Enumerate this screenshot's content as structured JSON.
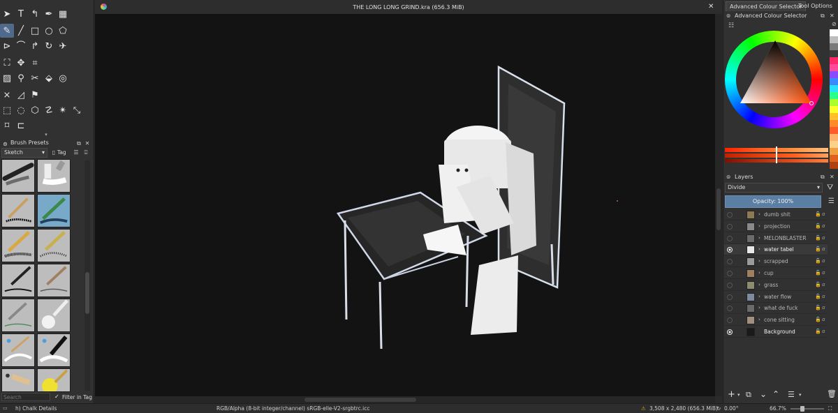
{
  "window": {
    "title": "THE LONG LONG GRIND.kra (656.3 MiB)",
    "close_glyph": "✕"
  },
  "toolbox": {
    "tools": [
      {
        "icon": "pointer-icon",
        "glyph": "➤"
      },
      {
        "icon": "text-tool-icon",
        "glyph": "T"
      },
      {
        "icon": "edit-shapes-icon",
        "glyph": "↰"
      },
      {
        "icon": "calligraphy-icon",
        "glyph": "✒"
      },
      {
        "icon": "assistant-tool-icon",
        "glyph": "▦"
      },
      {
        "icon": "freehand-brush-icon",
        "glyph": "✎"
      },
      {
        "icon": "line-tool-icon",
        "glyph": "╱"
      },
      {
        "icon": "rectangle-tool-icon",
        "glyph": "□"
      },
      {
        "icon": "ellipse-tool-icon",
        "glyph": "○"
      },
      {
        "icon": "polygon-tool-icon",
        "glyph": "⬠"
      },
      {
        "icon": "polyline-tool-icon",
        "glyph": "⊳"
      },
      {
        "icon": "bezier-curve-icon",
        "glyph": "⌒"
      },
      {
        "icon": "freehand-path-icon",
        "glyph": "↱"
      },
      {
        "icon": "dynamic-brush-icon",
        "glyph": "↻"
      },
      {
        "icon": "multibrush-icon",
        "glyph": "✈"
      },
      {
        "icon": "transform-tool-icon",
        "glyph": "⛶"
      },
      {
        "icon": "move-tool-icon",
        "glyph": "✥"
      },
      {
        "icon": "crop-tool-icon",
        "glyph": "⌗"
      },
      {
        "icon": "gradient-tool-icon",
        "glyph": "▨"
      },
      {
        "icon": "color-picker-icon",
        "glyph": "⚲"
      },
      {
        "icon": "smart-patch-icon",
        "glyph": "✂"
      },
      {
        "icon": "fill-tool-icon",
        "glyph": "⬙"
      },
      {
        "icon": "enclose-fill-icon",
        "glyph": "◎"
      },
      {
        "icon": "assistant-perspective-icon",
        "glyph": "⨯"
      },
      {
        "icon": "measure-tool-icon",
        "glyph": "◿"
      },
      {
        "icon": "reference-image-icon",
        "glyph": "⚑"
      },
      {
        "icon": "rect-select-icon",
        "glyph": "⬚"
      },
      {
        "icon": "ellipse-select-icon",
        "glyph": "◌"
      },
      {
        "icon": "polygon-select-icon",
        "glyph": "⬡"
      },
      {
        "icon": "freehand-select-icon",
        "glyph": "☡"
      },
      {
        "icon": "contiguous-select-icon",
        "glyph": "✴"
      },
      {
        "icon": "similar-select-icon",
        "glyph": "⤡"
      },
      {
        "icon": "bezier-select-icon",
        "glyph": "⌑"
      },
      {
        "icon": "magnetic-select-icon",
        "glyph": "⊏"
      }
    ]
  },
  "brush_presets": {
    "title": "Brush Presets",
    "tag_value": "Sketch",
    "tag_label": "Tag",
    "search_placeholder": "Search",
    "filter_label": "Filter in Tag",
    "filter_checked": true
  },
  "color_selector": {
    "tabs": [
      "Advanced Colour Selector",
      "Tool Options"
    ],
    "panel_title": "Advanced Colour Selector"
  },
  "layers": {
    "title": "Layers",
    "blend_mode": "Divide",
    "opacity_label": "Opacity: 100%",
    "items": [
      {
        "name": "dumb shit",
        "visible": false,
        "group": true,
        "selected": false,
        "thumb": "#8c7a55"
      },
      {
        "name": "projection",
        "visible": false,
        "group": true,
        "selected": false,
        "thumb": "#8a8a8a"
      },
      {
        "name": "MELONBLASTER",
        "visible": false,
        "group": true,
        "selected": false,
        "thumb": "#6b6b6b"
      },
      {
        "name": "water tabel",
        "visible": true,
        "group": true,
        "selected": true,
        "thumb": "#e8e8e8"
      },
      {
        "name": "scrapped",
        "visible": false,
        "group": true,
        "selected": false,
        "thumb": "#9a9a9a"
      },
      {
        "name": "cup",
        "visible": false,
        "group": true,
        "selected": false,
        "thumb": "#a08060"
      },
      {
        "name": "grass",
        "visible": false,
        "group": true,
        "selected": false,
        "thumb": "#8c8c6e"
      },
      {
        "name": "water flow",
        "visible": false,
        "group": true,
        "selected": false,
        "thumb": "#7e8aa0"
      },
      {
        "name": "what de fuck",
        "visible": false,
        "group": true,
        "selected": false,
        "thumb": "#6a6a6a"
      },
      {
        "name": "cone sitting",
        "visible": false,
        "group": true,
        "selected": false,
        "thumb": "#a09080"
      },
      {
        "name": "Background",
        "visible": true,
        "group": false,
        "selected": false,
        "thumb": "#1a1a1a"
      }
    ]
  },
  "status": {
    "brush_name": "h) Chalk Details",
    "color_profile": "RGB/Alpha (8-bit integer/channel)  sRGB-elle-V2-srgbtrc.icc",
    "image_size": "3,508 x 2,480 (656.3 MiB)",
    "rotation": "0.00°",
    "zoom": "66.7%"
  },
  "colors": {
    "accent": "#4f6a8a",
    "canvas_bg": "#131313",
    "panel_bg": "#313131"
  }
}
